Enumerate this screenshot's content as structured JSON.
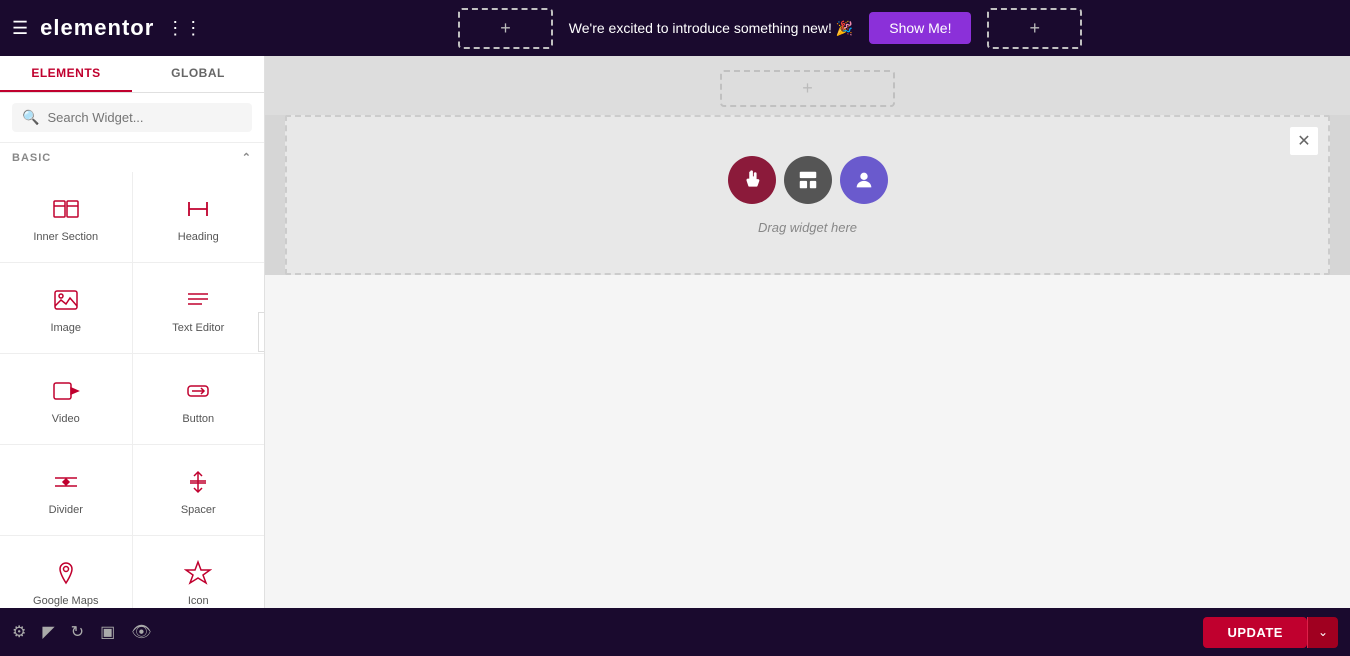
{
  "topbar": {
    "logo": "elementor",
    "announcement": "We're excited to introduce something new! 🎉",
    "show_me_label": "Show Me!"
  },
  "sidebar": {
    "tab_elements": "ELEMENTS",
    "tab_global": "GLOBAL",
    "search_placeholder": "Search Widget...",
    "section_label": "BASIC",
    "widgets": [
      {
        "id": "inner-section",
        "label": "Inner Section",
        "icon": "inner-section-icon"
      },
      {
        "id": "heading",
        "label": "Heading",
        "icon": "heading-icon"
      },
      {
        "id": "image",
        "label": "Image",
        "icon": "image-icon"
      },
      {
        "id": "text-editor",
        "label": "Text Editor",
        "icon": "text-editor-icon"
      },
      {
        "id": "video",
        "label": "Video",
        "icon": "video-icon"
      },
      {
        "id": "button",
        "label": "Button",
        "icon": "button-icon"
      },
      {
        "id": "divider",
        "label": "Divider",
        "icon": "divider-icon"
      },
      {
        "id": "spacer",
        "label": "Spacer",
        "icon": "spacer-icon"
      },
      {
        "id": "google-maps",
        "label": "Google Maps",
        "icon": "google-maps-icon"
      },
      {
        "id": "icon",
        "label": "Icon",
        "icon": "icon-icon"
      }
    ]
  },
  "canvas": {
    "drag_hint": "Drag widget here",
    "close_label": "×"
  },
  "bottombar": {
    "update_label": "UPDATE"
  }
}
